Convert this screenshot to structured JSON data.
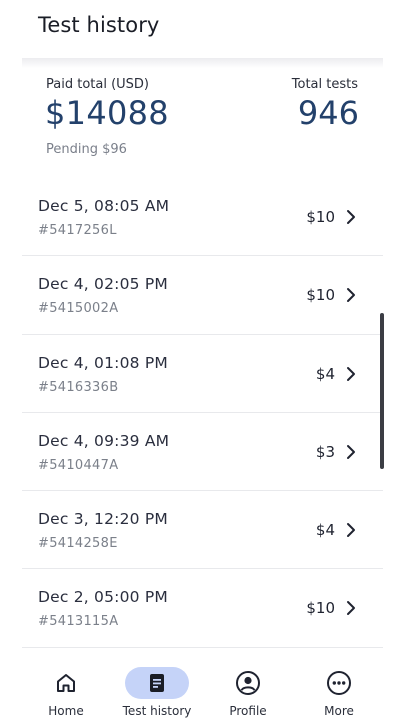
{
  "header": {
    "title": "Test history"
  },
  "summary": {
    "paid_label": "Paid total (USD)",
    "paid_value": "$14088",
    "pending": "Pending $96",
    "tests_label": "Total tests",
    "tests_value": "946"
  },
  "tests": [
    {
      "date": "Dec 5, 08:05 AM",
      "id": "#5417256L",
      "amount": "$10"
    },
    {
      "date": "Dec 4, 02:05 PM",
      "id": "#5415002A",
      "amount": "$10"
    },
    {
      "date": "Dec 4, 01:08 PM",
      "id": "#5416336B",
      "amount": "$4"
    },
    {
      "date": "Dec 4, 09:39 AM",
      "id": "#5410447A",
      "amount": "$3"
    },
    {
      "date": "Dec 3, 12:20 PM",
      "id": "#5414258E",
      "amount": "$4"
    },
    {
      "date": "Dec 2, 05:00 PM",
      "id": "#5413115A",
      "amount": "$10"
    }
  ],
  "nav": {
    "items": [
      {
        "label": "Home",
        "icon": "home-icon"
      },
      {
        "label": "Test history",
        "icon": "document-icon",
        "active": true
      },
      {
        "label": "Profile",
        "icon": "account-circle-icon"
      },
      {
        "label": "More",
        "icon": "more-horizontal-icon"
      }
    ]
  },
  "colors": {
    "accent_value": "#23416b",
    "nav_active_pill": "#c5d3f8"
  }
}
